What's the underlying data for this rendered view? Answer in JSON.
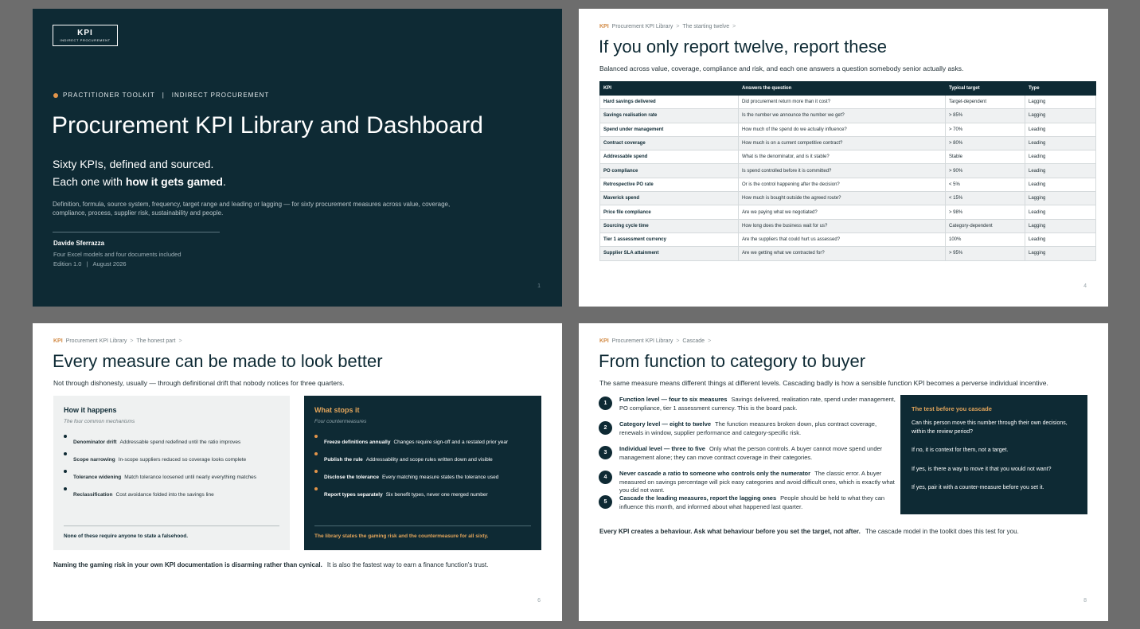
{
  "slide1": {
    "logo_big": "KPI",
    "logo_small": "INDIRECT PROCUREMENT",
    "kicker_left": "PRACTITIONER TOOLKIT",
    "kicker_sep": "|",
    "kicker_right": "INDIRECT PROCUREMENT",
    "title": "Procurement KPI Library and Dashboard",
    "sub_line1": "Sixty KPIs, defined and sourced.",
    "sub_line2_pre": "Each one with ",
    "sub_line2_bold": "how it gets gamed",
    "sub_line2_post": ".",
    "description": "Definition, formula, source system, frequency, target range and leading or lagging — for sixty procurement measures across value, coverage, compliance, process, supplier risk, sustainability and people.",
    "author": "Davide Sferrazza",
    "meta1": "Four Excel models and four documents included",
    "meta2": "Edition 1.0   |   August 2026",
    "page": "1"
  },
  "slide2": {
    "crumb_k": "KPI",
    "crumb_lib": "Procurement KPI Library",
    "crumb_sec": "The starting twelve",
    "gt": ">",
    "title": "If you only report twelve, report these",
    "lead": "Balanced across value, coverage, compliance and risk, and each one answers a question somebody senior actually asks.",
    "headers": [
      "KPI",
      "Answers the question",
      "Typical target",
      "Type"
    ],
    "rows": [
      [
        "Hard savings delivered",
        "Did procurement return more than it cost?",
        "Target-dependent",
        "Lagging"
      ],
      [
        "Savings realisation rate",
        "Is the number we announce the number we get?",
        "> 85%",
        "Lagging"
      ],
      [
        "Spend under management",
        "How much of the spend do we actually influence?",
        "> 70%",
        "Leading"
      ],
      [
        "Contract coverage",
        "How much is on a current competitive contract?",
        "> 80%",
        "Leading"
      ],
      [
        "Addressable spend",
        "What is the denominator, and is it stable?",
        "Stable",
        "Leading"
      ],
      [
        "PO compliance",
        "Is spend controlled before it is committed?",
        "> 90%",
        "Leading"
      ],
      [
        "Retrospective PO rate",
        "Or is the control happening after the decision?",
        "< 5%",
        "Leading"
      ],
      [
        "Maverick spend",
        "How much is bought outside the agreed route?",
        "< 15%",
        "Lagging"
      ],
      [
        "Price file compliance",
        "Are we paying what we negotiated?",
        "> 98%",
        "Leading"
      ],
      [
        "Sourcing cycle time",
        "How long does the business wait for us?",
        "Category-dependent",
        "Lagging"
      ],
      [
        "Tier 1 assessment currency",
        "Are the suppliers that could hurt us assessed?",
        "100%",
        "Leading"
      ],
      [
        "Supplier SLA attainment",
        "Are we getting what we contracted for?",
        "> 95%",
        "Lagging"
      ]
    ],
    "page": "4"
  },
  "slide3": {
    "crumb_k": "KPI",
    "crumb_lib": "Procurement KPI Library",
    "crumb_sec": "The honest part",
    "gt": ">",
    "title": "Every measure can be made to look better",
    "lead": "Not through dishonesty, usually — through definitional drift that nobody notices for three quarters.",
    "left": {
      "heading": "How it happens",
      "sub": "The four common mechanisms",
      "items": [
        {
          "b": "Denominator drift",
          "t": "Addressable spend redefined until the ratio improves"
        },
        {
          "b": "Scope narrowing",
          "t": "In-scope suppliers reduced so coverage looks complete"
        },
        {
          "b": "Tolerance widening",
          "t": "Match tolerance loosened until nearly everything matches"
        },
        {
          "b": "Reclassification",
          "t": "Cost avoidance folded into the savings line"
        }
      ],
      "footer": "None of these require anyone to state a falsehood."
    },
    "right": {
      "heading": "What stops it",
      "sub": "Four countermeasures",
      "items": [
        {
          "b": "Freeze definitions annually",
          "t": "Changes require sign-off and a restated prior year"
        },
        {
          "b": "Publish the rule",
          "t": "Addressability and scope rules written down and visible"
        },
        {
          "b": "Disclose the tolerance",
          "t": "Every matching measure states the tolerance used"
        },
        {
          "b": "Report types separately",
          "t": "Six benefit types, never one merged number"
        }
      ],
      "footer": "The library states the gaming risk and the countermeasure for all sixty."
    },
    "foot_bold": "Naming the gaming risk in your own KPI documentation is disarming rather than cynical.",
    "foot_text": "It is also the fastest way to earn a finance function's trust.",
    "page": "6"
  },
  "slide4": {
    "crumb_k": "KPI",
    "crumb_lib": "Procurement KPI Library",
    "crumb_sec": "Cascade",
    "gt": ">",
    "title": "From function to category to buyer",
    "lead": "The same measure means different things at different levels. Cascading badly is how a sensible function KPI becomes a perverse individual incentive.",
    "steps": [
      {
        "n": "1",
        "b": "Function level — four to six measures",
        "t": "Savings delivered, realisation rate, spend under management, PO compliance, tier 1 assessment currency. This is the board pack."
      },
      {
        "n": "2",
        "b": "Category level — eight to twelve",
        "t": "The function measures broken down, plus contract coverage, renewals in window, supplier performance and category-specific risk."
      },
      {
        "n": "3",
        "b": "Individual level — three to five",
        "t": "Only what the person controls. A buyer cannot move spend under management alone; they can move contract coverage in their categories."
      },
      {
        "n": "4",
        "b": "Never cascade a ratio to someone who controls only the numerator",
        "t": "The classic error. A buyer measured on savings percentage will pick easy categories and avoid difficult ones, which is exactly what you did not want."
      },
      {
        "n": "5",
        "b": "Cascade the leading measures, report the lagging ones",
        "t": "People should be held to what they can influence this month, and informed about what happened last quarter."
      }
    ],
    "test": {
      "heading": "The test before you cascade",
      "p1": "Can this person move this number through their own decisions, within the review period?",
      "p2": "If no, it is context for them, not a target.",
      "p3": "If yes, is there a way to move it that you would not want?",
      "p4": "If yes, pair it with a counter-measure before you set it."
    },
    "foot_bold": "Every KPI creates a behaviour. Ask what behaviour before you set the target, not after.",
    "foot_text": "The cascade model in the toolkit does this test for you.",
    "page": "8"
  },
  "colors": {
    "navy": "#0e2a34",
    "accent": "#e3954a",
    "card_light": "#eff1f1"
  }
}
